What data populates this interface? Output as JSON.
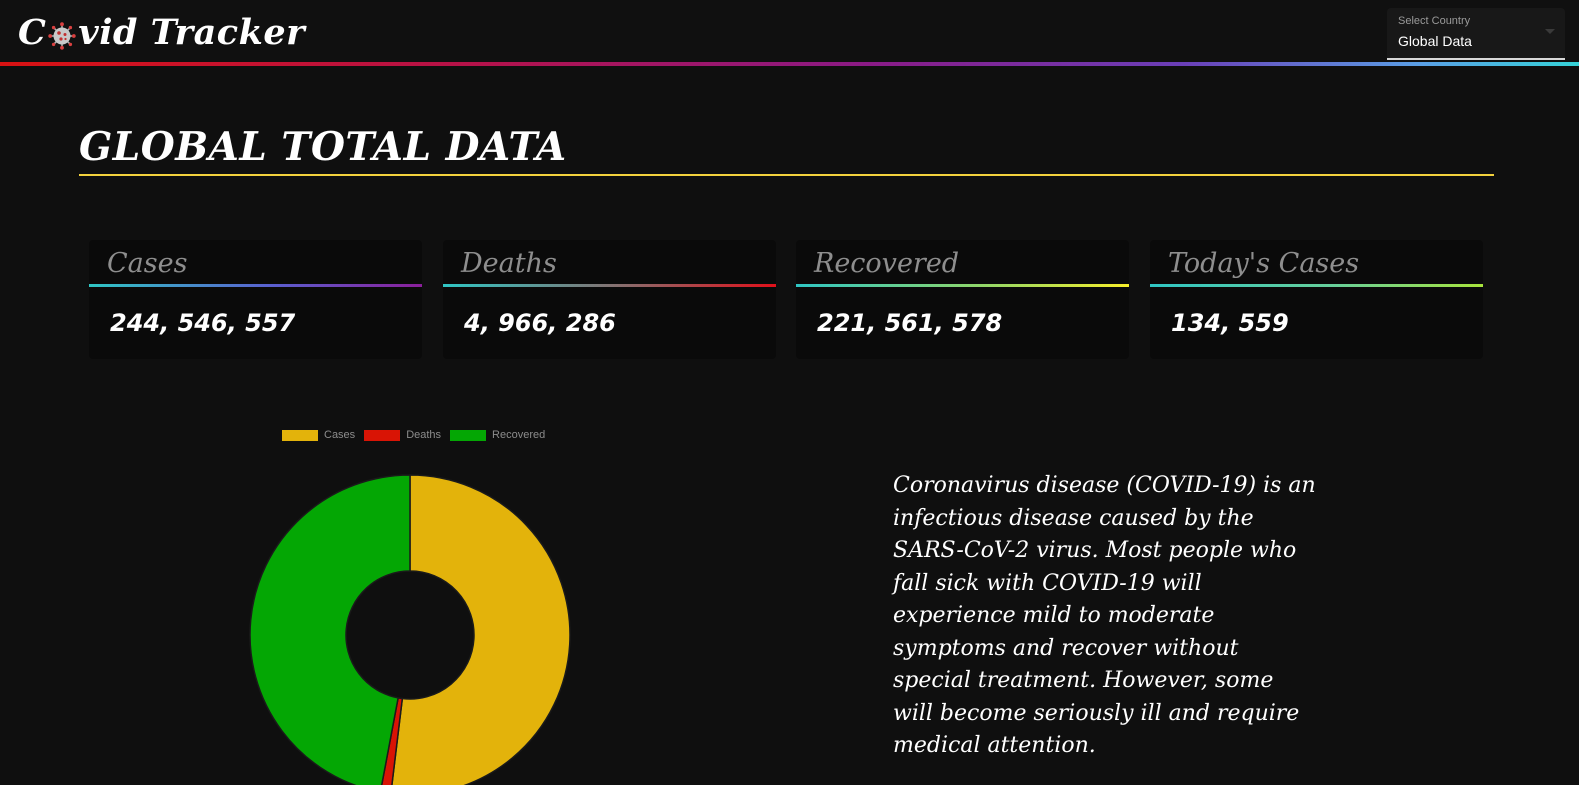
{
  "header": {
    "brand_prefix": "C",
    "brand_suffix": "vid Tracker",
    "brand_icon": "virus-icon",
    "country_select": {
      "label": "Select Country",
      "value": "Global Data"
    }
  },
  "main": {
    "title": "GLOBAL TOTAL DATA"
  },
  "stats": [
    {
      "title": "Cases",
      "value": "244, 546, 557"
    },
    {
      "title": "Deaths",
      "value": "4, 966, 286"
    },
    {
      "title": "Recovered",
      "value": "221, 561, 578"
    },
    {
      "title": "Today's Cases",
      "value": "134, 559"
    }
  ],
  "description": "Coronavirus disease (COVID-19) is an infectious disease caused by the SARS-CoV-2 virus. Most people who fall sick with COVID-19 will experience mild to moderate symptoms and recover without special treatment. However, some will become seriously ill and require medical attention.",
  "chart_data": {
    "type": "pie",
    "variant": "doughnut",
    "categories": [
      "Cases",
      "Deaths",
      "Recovered"
    ],
    "values": [
      244546557,
      4966286,
      221561578
    ],
    "colors": [
      "#e3b30b",
      "#d91405",
      "#04a704"
    ],
    "legend_position": "top"
  },
  "colors": {
    "background": "#0f0f0f",
    "title_underline": "#f2d13d"
  }
}
